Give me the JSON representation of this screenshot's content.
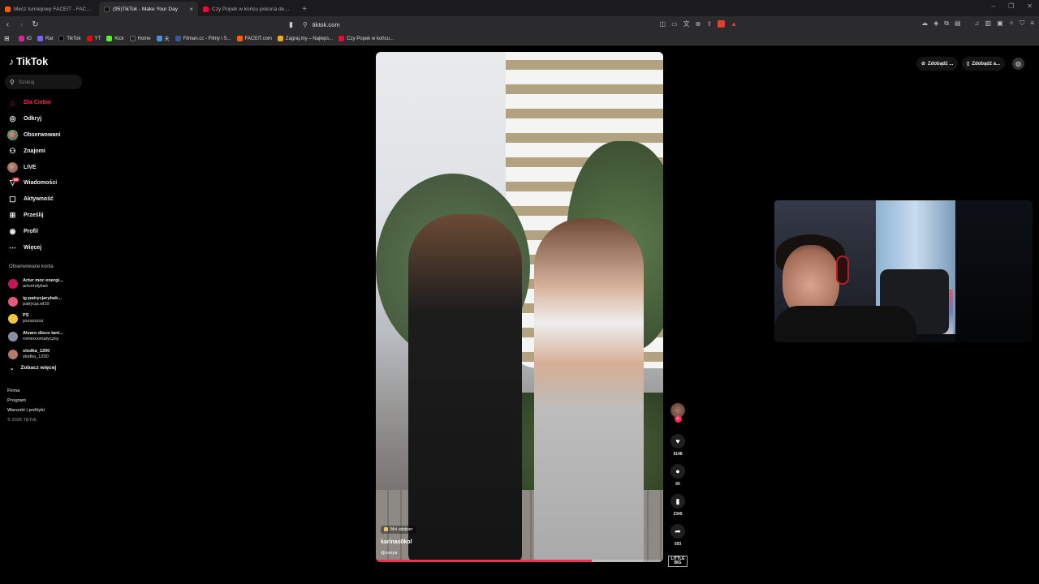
{
  "browser": {
    "tabs": [
      {
        "title": "Mecz turniejowy FACEIT - FACEIT.com",
        "color": "#fe5f00",
        "active": false
      },
      {
        "title": "(95)TikTok - Make Your Day",
        "color": "#111111",
        "active": true
      },
      {
        "title": "Czy Popek w końcu pokona demony",
        "color": "#ff0033",
        "active": false
      }
    ],
    "new_tab": "+",
    "url": "tiktok.com",
    "bookmarks": [
      {
        "label": "IG",
        "color": "#d6249f"
      },
      {
        "label": "Rat",
        "color": "#7b61ff"
      },
      {
        "label": "TikTok",
        "color": "#000000"
      },
      {
        "label": "YT",
        "color": "#ff0000"
      },
      {
        "label": "Kick",
        "color": "#53fc18"
      },
      {
        "label": "Home",
        "color": "#222222"
      },
      {
        "label": "天",
        "color": "#4a90e2"
      },
      {
        "label": "Filman.cc - Filmy i S...",
        "color": "#3b5998"
      },
      {
        "label": "FACEIT.com",
        "color": "#fe5f00"
      },
      {
        "label": "Zagraj.my – Najleps...",
        "color": "#f5a623"
      },
      {
        "label": "Czy Popek w końcu...",
        "color": "#ff0033"
      }
    ]
  },
  "tiktok": {
    "logo": "TikTok",
    "search_placeholder": "Szukaj",
    "menu": [
      {
        "label": "Dla Ciebie",
        "icon": "home-icon",
        "active": true
      },
      {
        "label": "Odkryj",
        "icon": "compass-icon"
      },
      {
        "label": "Obserwowani",
        "icon": "following-icon"
      },
      {
        "label": "Znajomi",
        "icon": "friends-icon"
      },
      {
        "label": "LIVE",
        "icon": "live-icon"
      },
      {
        "label": "Wiadomości",
        "icon": "messages-icon",
        "badge": "99"
      },
      {
        "label": "Aktywność",
        "icon": "activity-icon"
      },
      {
        "label": "Prześlij",
        "icon": "upload-icon"
      },
      {
        "label": "Profil",
        "icon": "profile-icon"
      },
      {
        "label": "Więcej",
        "icon": "more-icon"
      }
    ],
    "followed_title": "Obserwowane konta",
    "followed": [
      {
        "name": "Artur moc energi...",
        "handle": "arturindykaó",
        "color": "#c2185b"
      },
      {
        "name": "ig:patrycjarybak...",
        "handle": "patrycja.wl10",
        "color": "#e85a7a"
      },
      {
        "name": "PS",
        "handle": "pszszszsz",
        "color": "#f4c542"
      },
      {
        "name": "Alvaro disco tani...",
        "handle": "romeoromatyczny",
        "color": "#8a8fa3"
      },
      {
        "name": "slodka_1200",
        "handle": "slodka_1200",
        "color": "#b07a6a"
      }
    ],
    "see_more": "Zobacz więcej",
    "footer": [
      "Firma",
      "Program",
      "Warunki i polityki"
    ],
    "copyright": "© 2025 TikTok",
    "get_app_1": "Zdobądź ...",
    "get_app_2": "Zdobądź a..."
  },
  "video": {
    "effect": "Moi эффект",
    "username": "karinas0kol",
    "sound": "@sonya",
    "progress": 0.75,
    "likes": "9148",
    "comments": "60",
    "saves": "2349",
    "shares": "593",
    "music_tag": "LITTLE BIG"
  },
  "colors": {
    "accent": "#fe2c55",
    "background": "#000000"
  }
}
